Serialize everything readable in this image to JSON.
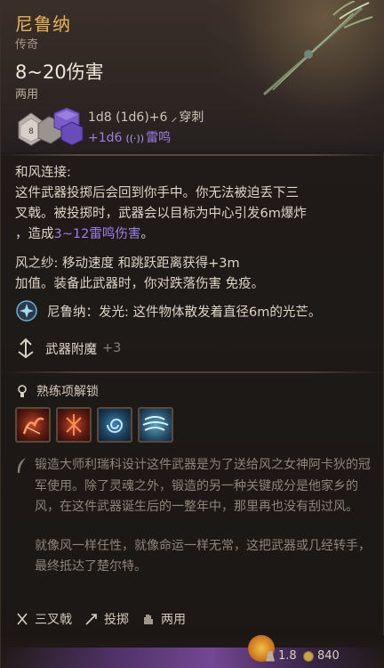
{
  "item": {
    "name": "尼鲁纳",
    "rarity": "传奇",
    "damage": "8~20伤害",
    "handedness": "两用",
    "damage_roll": "1d8 (1d6)+6",
    "damage_type": "穿刺",
    "bonus_roll": "+1d6",
    "bonus_type": "雷鸣",
    "dice_labels": [
      "8",
      "6"
    ]
  },
  "description": {
    "heading": "和风连接:",
    "line1": "这件武器投掷后会回到你手中。你无法被迫丢下三",
    "line2": "叉戟。被投掷时，武器会以目标为中心引发6m爆炸",
    "line3_prefix": "，造成",
    "line3_purple": "3~12雷鸣伤害",
    "line3_suffix": "。",
    "wind_line1": "风之纱: 移动速度 和跳跃距离获得+3m",
    "wind_line2": "加值。装备此武器时，你对跌落伤害 免疫。"
  },
  "passive": {
    "text": "尼鲁纳：发光: 这件物体散发着直径6m的光芒。"
  },
  "enchant": {
    "label": "武器附魔",
    "value": "+3"
  },
  "proficiency": {
    "label": "熟练项解锁",
    "skills": [
      "skill-flame",
      "skill-rune",
      "skill-swirl",
      "skill-wind"
    ]
  },
  "lore": {
    "p1": "锻造大师利瑞科设计这件武器是为了送给风之女神阿卡狄的冠军使用。除了灵魂之外，锻造的另一种关键成分是他家乡的风，在这件武器诞生后的一整年中，那里再也没有刮过风。",
    "p2": "就像风一样任性，就像命运一样无常，这把武器或几经转手，最终抵达了楚尔特。"
  },
  "footer": {
    "type": "三叉戟",
    "throw": "投掷",
    "hands": "两用"
  },
  "status": {
    "weight": "1.8",
    "gold": "840"
  },
  "colors": {
    "title": "#e9b257",
    "purple": "#9c7fe6"
  }
}
